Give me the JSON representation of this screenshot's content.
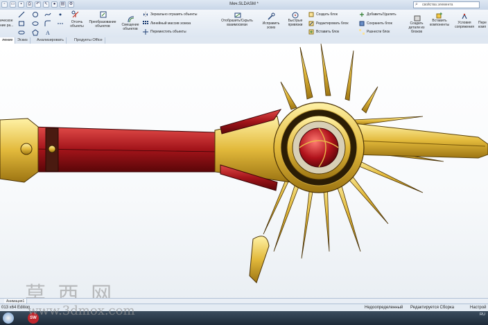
{
  "window": {
    "title": "Меч.SLDASM *",
    "search_placeholder": "свойства элемента"
  },
  "ribbon": {
    "sketch_label": "Эскиз",
    "left_cut_label": "ическое",
    "left_cut_label2": "ние ра...",
    "trim_label": "Отсечь объекты",
    "convert_label": "Преобразование объектов",
    "offset_label": "Смещение объектов",
    "mirror_label": "Зеркально отразить объекты",
    "linear_label": "Линейный массив эскиза",
    "move_label": "Переместить объекты",
    "display_label": "Отобразить/Скрыть взаимосвязи",
    "repair_label": "Исправить эскиз",
    "quick_label": "Быстрые привязки",
    "make_block_label": "Создать блок",
    "edit_block_label": "Редактировать блок",
    "insert_block_label": "Вставить блок",
    "add_remove_label": "Добавить/Удалить",
    "save_block_label": "Сохранить блок",
    "explode_block_label": "Разнести блок",
    "create_from_block_label": "Создать детали из блоков",
    "insert_comp_label": "Вставить компоненты",
    "mate_label": "Условия сопряжения",
    "move_comp_label": "Пере комп"
  },
  "tabs": [
    "ление",
    "Эскиз",
    "Анализировать",
    "Продукты Office"
  ],
  "bottom_tabs": [
    "Анимация1"
  ],
  "status": {
    "edition": "013 x64 Edition",
    "underdefined": "Недоопределенный",
    "editing": "Редактируется Сборка",
    "settings": "Настрой"
  },
  "taskbar": {
    "lang": "RU",
    "sw_label": "SW"
  },
  "watermark": {
    "line1": "莫 西 网",
    "line2": "www.3dmox.com"
  },
  "colors": {
    "ribbon_top": "#f3f6fa",
    "accent": "#3a6ea5",
    "blade": "#e2b93b",
    "grip": "#a3141a"
  }
}
